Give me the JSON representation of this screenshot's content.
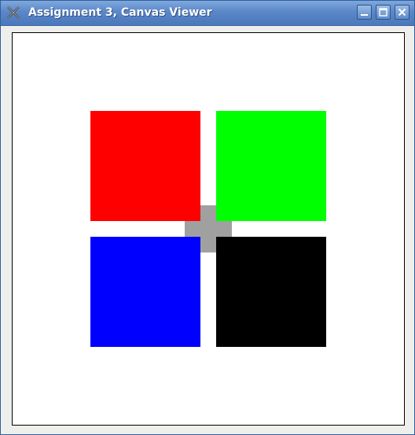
{
  "window": {
    "title": "Assignment 3, Canvas Viewer",
    "icons": {
      "app": "tools-icon",
      "minimize": "minimize-icon",
      "maximize": "maximize-icon",
      "close": "close-icon"
    }
  },
  "canvas": {
    "background": "#ffffff",
    "shapes": [
      {
        "name": "gray-cross",
        "color": "#a0a0a0"
      },
      {
        "name": "red-square",
        "color": "#ff0000"
      },
      {
        "name": "green-square",
        "color": "#00ff00"
      },
      {
        "name": "blue-square",
        "color": "#0000ff"
      },
      {
        "name": "black-square",
        "color": "#000000"
      }
    ]
  }
}
